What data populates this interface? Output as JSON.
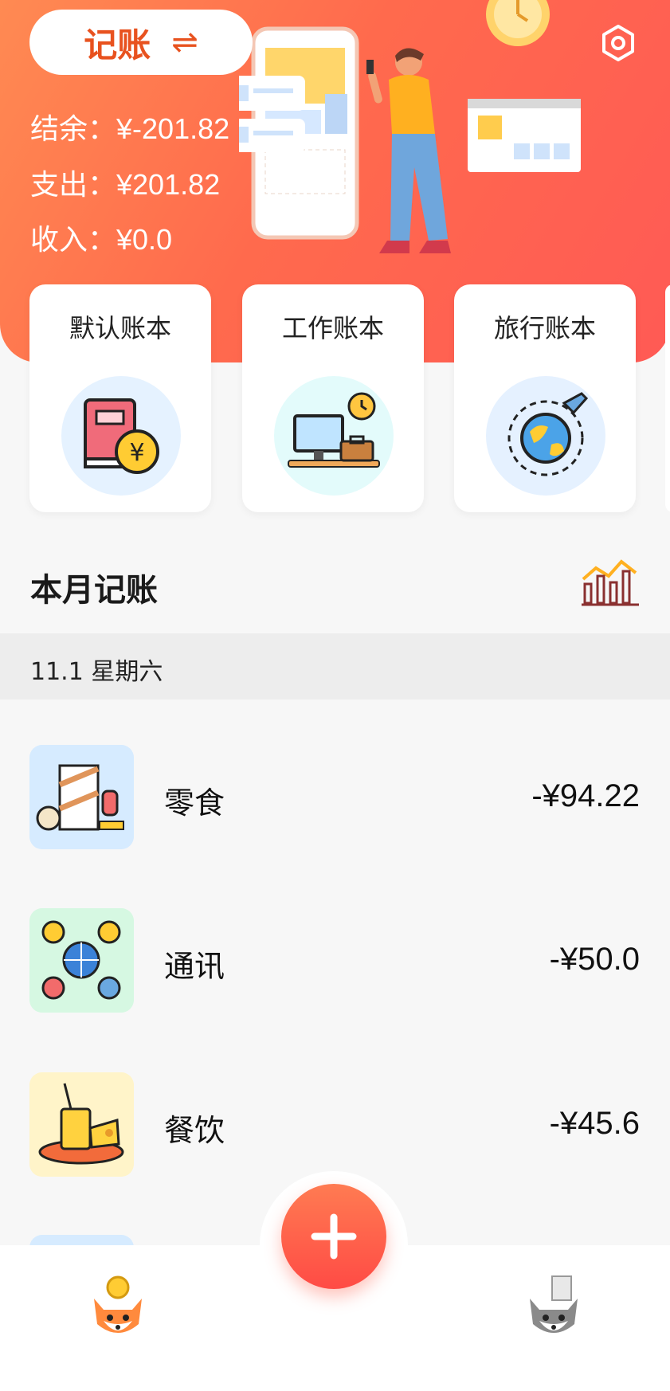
{
  "header": {
    "switch_label": "记账",
    "switch_icon": "⇌",
    "balance_label": "结余：",
    "balance_value": "¥-201.82",
    "expense_label": "支出：",
    "expense_value": "¥201.82",
    "income_label": "收入：",
    "income_value": "¥0.0"
  },
  "books": [
    {
      "title": "默认账本",
      "icon": "book-yen-icon"
    },
    {
      "title": "工作账本",
      "icon": "computer-briefcase-icon"
    },
    {
      "title": "旅行账本",
      "icon": "globe-plane-icon"
    }
  ],
  "month": {
    "title": "本月记账"
  },
  "day": {
    "label": "11.1 星期六"
  },
  "records": [
    {
      "name": "零食",
      "amount": "-¥94.22",
      "icon": "snacks-icon"
    },
    {
      "name": "通讯",
      "amount": "-¥50.0",
      "icon": "communication-icon"
    },
    {
      "name": "餐饮",
      "amount": "-¥45.6",
      "icon": "food-drink-icon"
    }
  ],
  "tabbar": {
    "left_icon": "fox-coin-icon",
    "center_icon": "plus-icon",
    "right_icon": "fox-receipt-icon"
  },
  "colors": {
    "accent": "#ff6a4d",
    "switch_text": "#e8521f"
  }
}
